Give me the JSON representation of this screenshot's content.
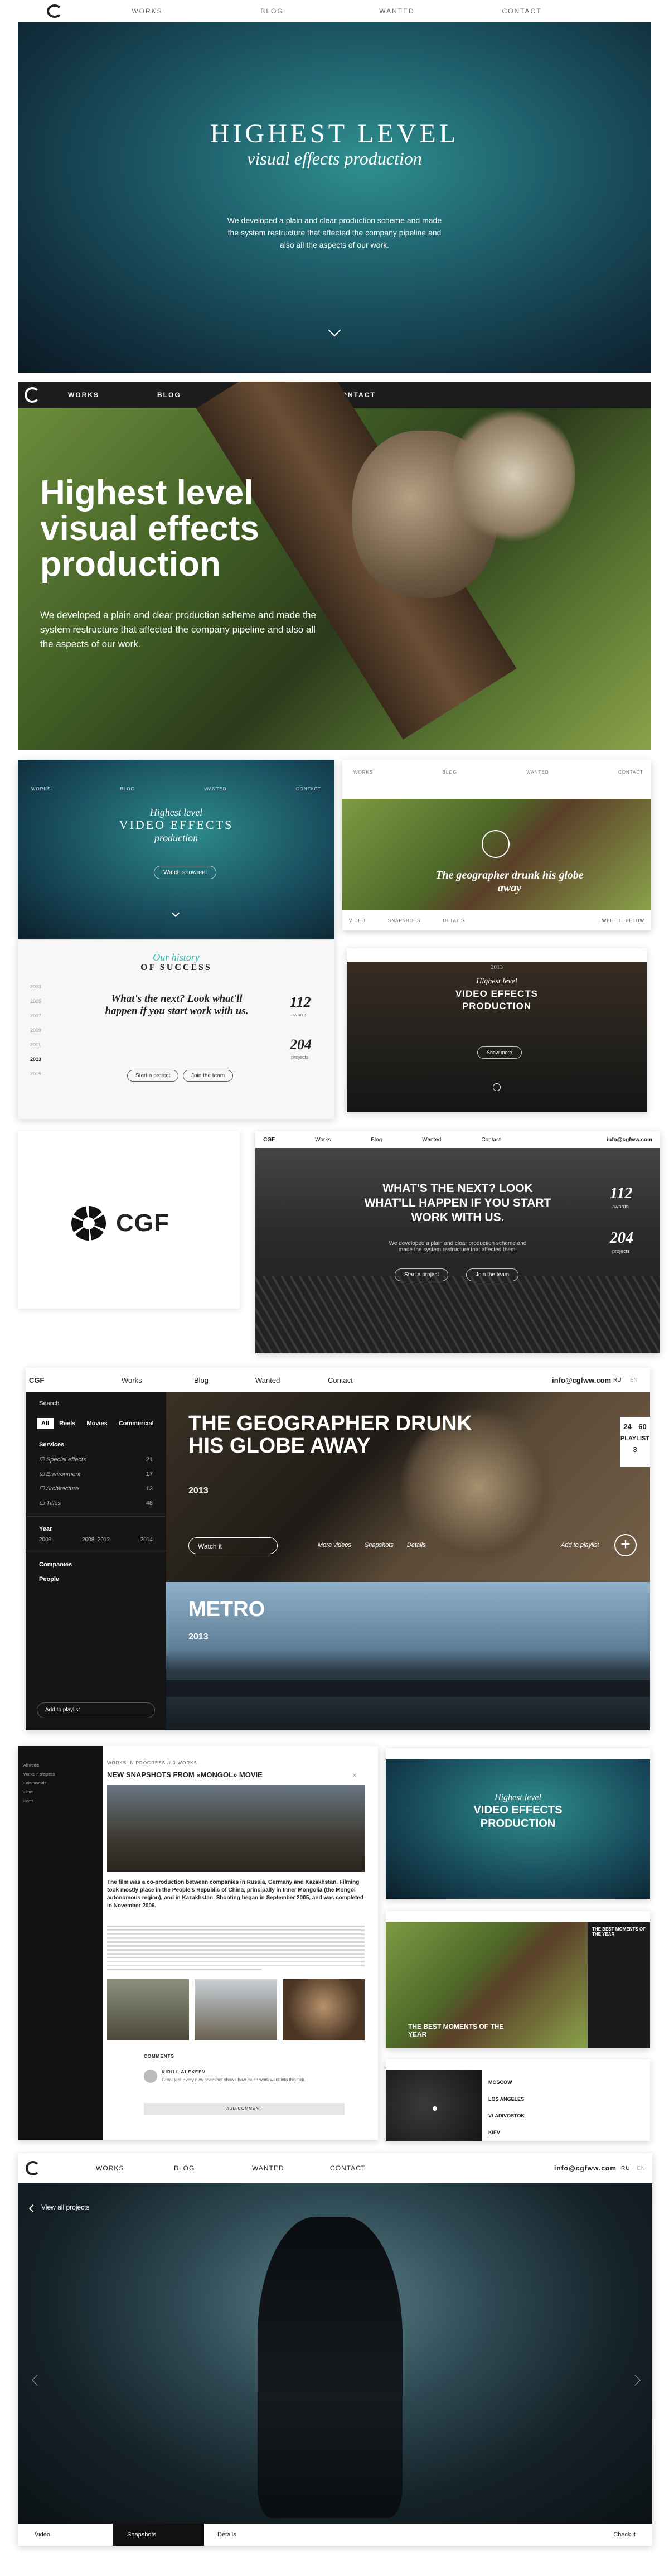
{
  "nav": {
    "works": "WORKS",
    "blog": "BLOG",
    "wanted": "WANTED",
    "contact": "CONTACT"
  },
  "hero1": {
    "title": "HIGHEST LEVEL",
    "subtitle": "visual effects production",
    "body": "We developed a plain and clear production scheme and made the system restructure that affected the company pipeline and also all the aspects of our work."
  },
  "hero2": {
    "title": "Highest level visual effects production",
    "body": "We developed a plain and clear production scheme and made the system restructure that affected the company pipeline and also all the aspects of our work."
  },
  "mini1": {
    "title1": "Highest level",
    "title2": "VIDEO EFFECTS",
    "title3": "production",
    "btn": "Watch showreel"
  },
  "mini2": {
    "title": "The geographer drunk his globe away",
    "tabs": [
      "Video",
      "Snapshots",
      "Details"
    ],
    "right": "Tweet it below"
  },
  "mini3": {
    "kicker": "Our history",
    "heading": "OF SUCCESS",
    "question": "What's the next? Look what'll happen if you start work with us.",
    "btn1": "Start a project",
    "btn2": "Join the team",
    "years": [
      "2003",
      "2005",
      "2007",
      "2009",
      "2011",
      "2013",
      "2015"
    ],
    "active_year": "2013",
    "stat1_num": "112",
    "stat1_label": "awards",
    "stat2_num": "204",
    "stat2_label": "projects"
  },
  "mini4": {
    "year": "2013",
    "title1": "Highest level",
    "title2": "VIDEO EFFECTS",
    "title3": "PRODUCTION",
    "btn": "Show more"
  },
  "logo": {
    "text": "CGF"
  },
  "next": {
    "brand": "CGF",
    "nav": [
      "Works",
      "Blog",
      "Wanted",
      "Contact"
    ],
    "email": "info@cgfww.com",
    "title": "WHAT'S THE NEXT? LOOK WHAT'LL HAPPEN IF YOU START WORK WITH US.",
    "body": "We developed a plain and clear production scheme and made the system restructure that affected them.",
    "btn1": "Start a project",
    "btn2": "Join the team",
    "stat1_num": "112",
    "stat1_label": "awards",
    "stat2_num": "204",
    "stat2_label": "projects"
  },
  "works": {
    "brand": "CGF",
    "nav": [
      "Works",
      "Blog",
      "Wanted",
      "Contact"
    ],
    "email": "info@cgfww.com",
    "lang": [
      "RU",
      "EN"
    ],
    "search": "Search",
    "filters": [
      "All",
      "Reels",
      "Movies",
      "Commercial"
    ],
    "services_label": "Services",
    "services": [
      {
        "name": "Special effects",
        "count": "21",
        "checked": true
      },
      {
        "name": "Environment",
        "count": "17",
        "checked": true
      },
      {
        "name": "Architecture",
        "count": "13",
        "checked": false
      },
      {
        "name": "Titles",
        "count": "48",
        "checked": false
      }
    ],
    "year_label": "Year",
    "year_from": "2009",
    "year_range": "2008–2012",
    "year_to": "2014",
    "companies_label": "Companies",
    "people_label": "People",
    "playlist_btn": "Add to playlist",
    "item1_title": "THE GEOGRAPHER DRUNK HIS GLOBE AWAY",
    "item1_year": "2013",
    "item1_watch": "Watch it",
    "item1_links": [
      "More videos",
      "Snapshots",
      "Details"
    ],
    "item1_add": "Add to playlist",
    "playlist_counts": [
      "24",
      "60"
    ],
    "playlist_label": "PLAYLIST",
    "playlist_num": "3",
    "item2_title": "METRO",
    "item2_year": "2013"
  },
  "article": {
    "crumb": "WORKS IN PROGRESS  //  3 WORKS",
    "title": "NEW SNAPSHOTS FROM «MONGOL» MOVIE",
    "lead": "The film was a co-production between companies in Russia, Germany and Kazakhstan. Filming took mostly place in the People's Republic of China, principally in Inner Mongolia (the Mongol autonomous region), and in Kazakhstan. Shooting began in September 2005, and was completed in November 2006.",
    "comments_label": "COMMENTS",
    "comment_author": "KIRILL ALEXEEV",
    "comment_text": "Great job! Every new snapshot shows how much work went into this film.",
    "add_comment": "Add comment",
    "menu": [
      "All works",
      "Works in progress",
      "Commercials",
      "Films",
      "Reels"
    ]
  },
  "mini5": {
    "title1": "Highest level",
    "title2": "VIDEO EFFECTS",
    "title3": "PRODUCTION"
  },
  "mini6": {
    "title": "THE BEST MOMENTS OF THE YEAR",
    "sidebar_title": "THE BEST MOMENTS OF THE YEAR"
  },
  "mini7": {
    "cities": [
      "MOSCOW",
      "LOS ANGELES",
      "VLADIVOSTOK",
      "KIEV"
    ]
  },
  "film": {
    "nav": [
      "WORKS",
      "BLOG",
      "WANTED",
      "CONTACT"
    ],
    "email": "info@cgfww.com",
    "lang": [
      "RU",
      "EN"
    ],
    "back": "View all projects",
    "tabs": [
      "Video",
      "Snapshots",
      "Details"
    ],
    "check": "Check it"
  },
  "colors": {
    "dark": "#1b1b1b",
    "accent": "#2bb8b0",
    "teal": "#1f5560"
  }
}
